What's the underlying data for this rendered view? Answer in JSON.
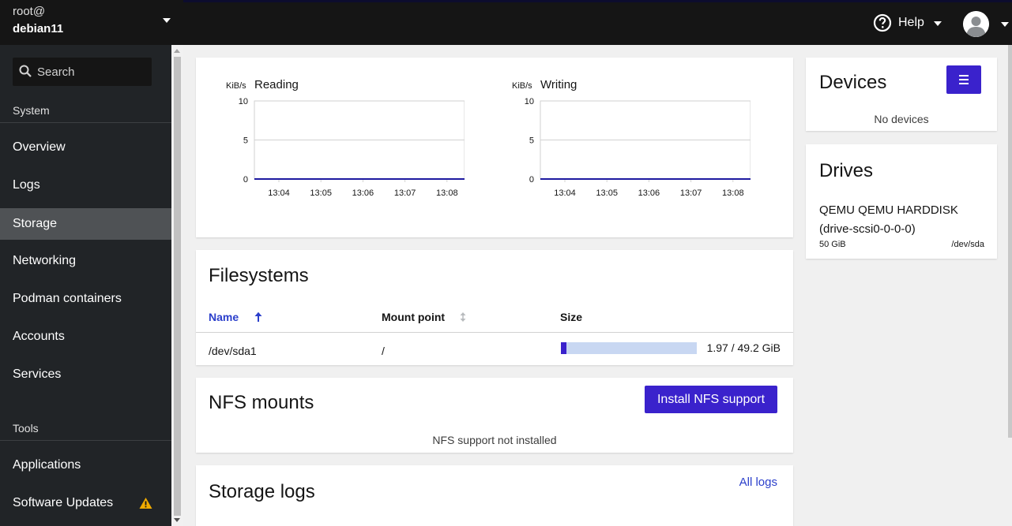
{
  "host": {
    "user": "root@",
    "name": "debian11"
  },
  "search": {
    "placeholder": "Search"
  },
  "nav": {
    "sections": [
      {
        "label": "System"
      },
      {
        "label": "Tools"
      }
    ],
    "items": [
      {
        "label": "Overview"
      },
      {
        "label": "Logs"
      },
      {
        "label": "Storage",
        "active": true
      },
      {
        "label": "Networking"
      },
      {
        "label": "Podman containers"
      },
      {
        "label": "Accounts"
      },
      {
        "label": "Services"
      },
      {
        "label": "Applications"
      },
      {
        "label": "Software Updates",
        "icon": "warning-icon"
      }
    ]
  },
  "topbar": {
    "help_label": "Help",
    "help_icon": "question-circle-icon",
    "avatar_icon": "user-avatar-icon"
  },
  "graphs": [
    {
      "title": "Reading",
      "unit": "KiB/s"
    },
    {
      "title": "Writing",
      "unit": "KiB/s"
    }
  ],
  "chart_data": [
    {
      "type": "line",
      "title": "Reading",
      "ylabel": "KiB/s",
      "ylim": [
        0,
        10
      ],
      "yticks": [
        "0",
        "5",
        "10"
      ],
      "categories": [
        "13:04",
        "13:05",
        "13:06",
        "13:07",
        "13:08"
      ],
      "series": [
        {
          "values": [
            0,
            0,
            0,
            0,
            0
          ]
        }
      ],
      "grid": true
    },
    {
      "type": "line",
      "title": "Writing",
      "ylabel": "KiB/s",
      "ylim": [
        0,
        10
      ],
      "yticks": [
        "0",
        "5",
        "10"
      ],
      "categories": [
        "13:04",
        "13:05",
        "13:06",
        "13:07",
        "13:08"
      ],
      "series": [
        {
          "values": [
            0,
            0,
            0,
            0,
            0
          ]
        }
      ],
      "grid": true
    }
  ],
  "devices": {
    "title": "Devices",
    "empty": "No devices",
    "menu_icon": "hamburger-menu-icon"
  },
  "drives": {
    "title": "Drives",
    "items": [
      {
        "name": "QEMU QEMU HARDDISK (drive-scsi0-0-0-0)",
        "size": "50 GiB",
        "device": "/dev/sda"
      }
    ]
  },
  "filesystems": {
    "title": "Filesystems",
    "columns": {
      "name": "Name",
      "mount": "Mount point",
      "size": "Size"
    },
    "rows": [
      {
        "device": "/dev/sda1",
        "mount": "/",
        "size_text": "1.97 / 49.2 GiB",
        "used_fraction": 0.04
      }
    ]
  },
  "nfs": {
    "title": "NFS mounts",
    "button": "Install NFS support",
    "empty": "NFS support not installed"
  },
  "storage_logs": {
    "title": "Storage logs",
    "link": "All logs"
  },
  "colors": {
    "accent": "#3a22cc",
    "link": "#2b3fcb",
    "sidebar": "#212427",
    "topbar": "#151515",
    "warning": "#f0ab00"
  }
}
